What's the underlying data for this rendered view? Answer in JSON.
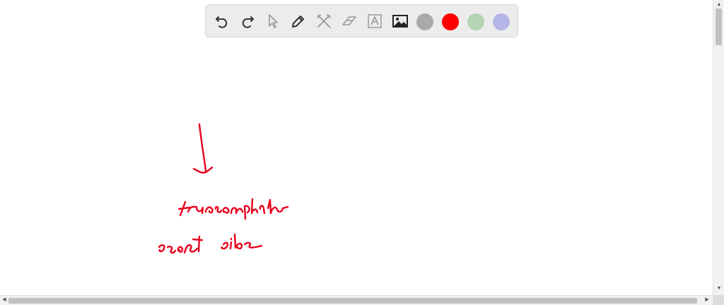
{
  "toolbar": {
    "tools": [
      {
        "name": "undo-icon",
        "enabled": true
      },
      {
        "name": "redo-icon",
        "enabled": true
      },
      {
        "name": "select-pointer-icon",
        "enabled": false
      },
      {
        "name": "pen-icon",
        "enabled": true
      },
      {
        "name": "tools-icon",
        "enabled": false
      },
      {
        "name": "eraser-icon",
        "enabled": false
      },
      {
        "name": "text-icon",
        "enabled": false
      },
      {
        "name": "image-icon",
        "enabled": true
      }
    ],
    "colors": [
      "#a9a9a9",
      "#ff0000",
      "#b5d5b5",
      "#b5b5e8"
    ],
    "selected_color": "#ff0000"
  },
  "ink_color": "#e8001c"
}
